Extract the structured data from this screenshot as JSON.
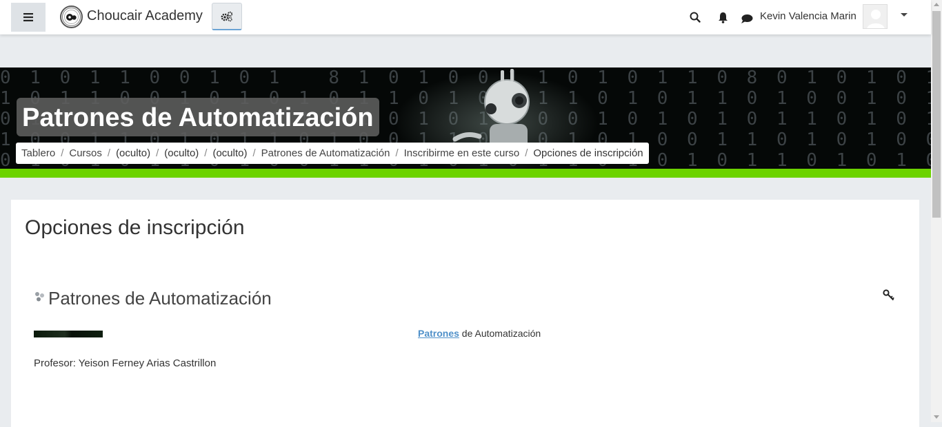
{
  "navbar": {
    "site_name": "Choucair Academy",
    "drawer_icon": "hamburger-icon",
    "admin_icon": "gears-icon",
    "user_name": "Kevin Valencia Marin",
    "icons": [
      "search-icon",
      "bell-icon",
      "chat-icon",
      "chevron-down-icon"
    ]
  },
  "header": {
    "course_title": "Patrones de Automatización",
    "breadcrumb": [
      "Tablero",
      "Cursos",
      "(oculto)",
      "(oculto)",
      "(oculto)",
      "Patrones de Automatización",
      "Inscribirme en este curso",
      "Opciones de inscripción"
    ],
    "separator": "/",
    "accent_color": "#6cd300"
  },
  "main": {
    "page_title": "Opciones de inscripción",
    "course": {
      "name": "Patrones de Automatización",
      "summary_link": "Patrones",
      "summary_rest": " de Automatización",
      "teacher": "Profesor: Yeison Ferney Arias Castrillon",
      "enrol_icon": "key-icon"
    }
  }
}
